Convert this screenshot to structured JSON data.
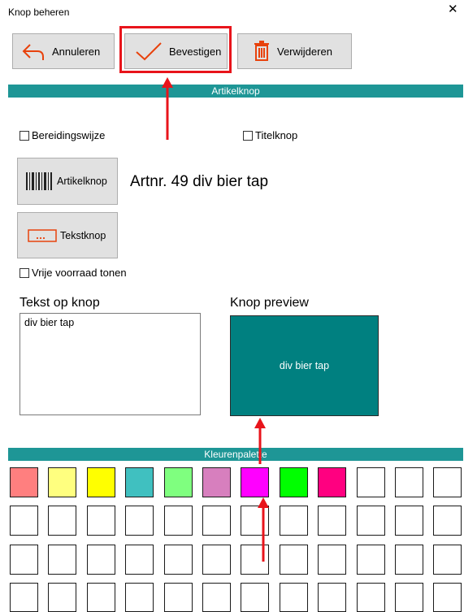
{
  "window": {
    "title": "Knop beheren",
    "close_glyph": "✕"
  },
  "toolbar": {
    "cancel": {
      "label": "Annuleren",
      "icon": "undo-arrow-icon"
    },
    "confirm": {
      "label": "Bevestigen",
      "icon": "checkmark-icon"
    },
    "delete": {
      "label": "Verwijderen",
      "icon": "trash-icon"
    }
  },
  "sections": {
    "article": "Artikelknop",
    "palette": "Kleurenpalette"
  },
  "options": {
    "preparation": {
      "label": "Bereidingswijze",
      "checked": false
    },
    "title_button": {
      "label": "Titelknop",
      "checked": false
    },
    "free_stock": {
      "label": "Vrije voorraad tonen",
      "checked": false
    }
  },
  "type_buttons": {
    "article": {
      "label": "Artikelknop",
      "icon": "barcode-icon"
    },
    "text": {
      "label": "Tekstknop",
      "icon": "textbox-icon"
    }
  },
  "article_info": "Artnr. 49 div bier tap",
  "text_editor": {
    "heading": "Tekst op knop",
    "value": "div bier tap"
  },
  "preview": {
    "heading": "Knop preview",
    "label": "div bier tap",
    "color": "#008080"
  },
  "palette_colors": [
    "#ff7f7f",
    "#ffff7f",
    "#ffff00",
    "#40c0c0",
    "#7fff7f",
    "#d77fbe",
    "#ff00ff",
    "#00ff00",
    "#ff0080",
    "#ffffff",
    "#ffffff",
    "#ffffff",
    "#ffffff",
    "#ffffff",
    "#ffffff",
    "#ffffff",
    "#ffffff",
    "#ffffff",
    "#ffffff",
    "#ffffff",
    "#ffffff",
    "#ffffff",
    "#ffffff",
    "#ffffff",
    "#ffffff",
    "#ffffff",
    "#ffffff",
    "#ffffff",
    "#ffffff",
    "#ffffff",
    "#ffffff",
    "#ffffff",
    "#ffffff",
    "#ffffff",
    "#ffffff",
    "#ffffff",
    "#ffffff",
    "#ffffff",
    "#ffffff",
    "#ffffff",
    "#ffffff",
    "#ffffff",
    "#ffffff",
    "#ffffff",
    "#ffffff",
    "#ffffff",
    "#ffffff",
    "#ffffff"
  ],
  "colors": {
    "accent": "#1e9696",
    "highlight": "#e8141b",
    "icon_orange": "#e8420c"
  }
}
